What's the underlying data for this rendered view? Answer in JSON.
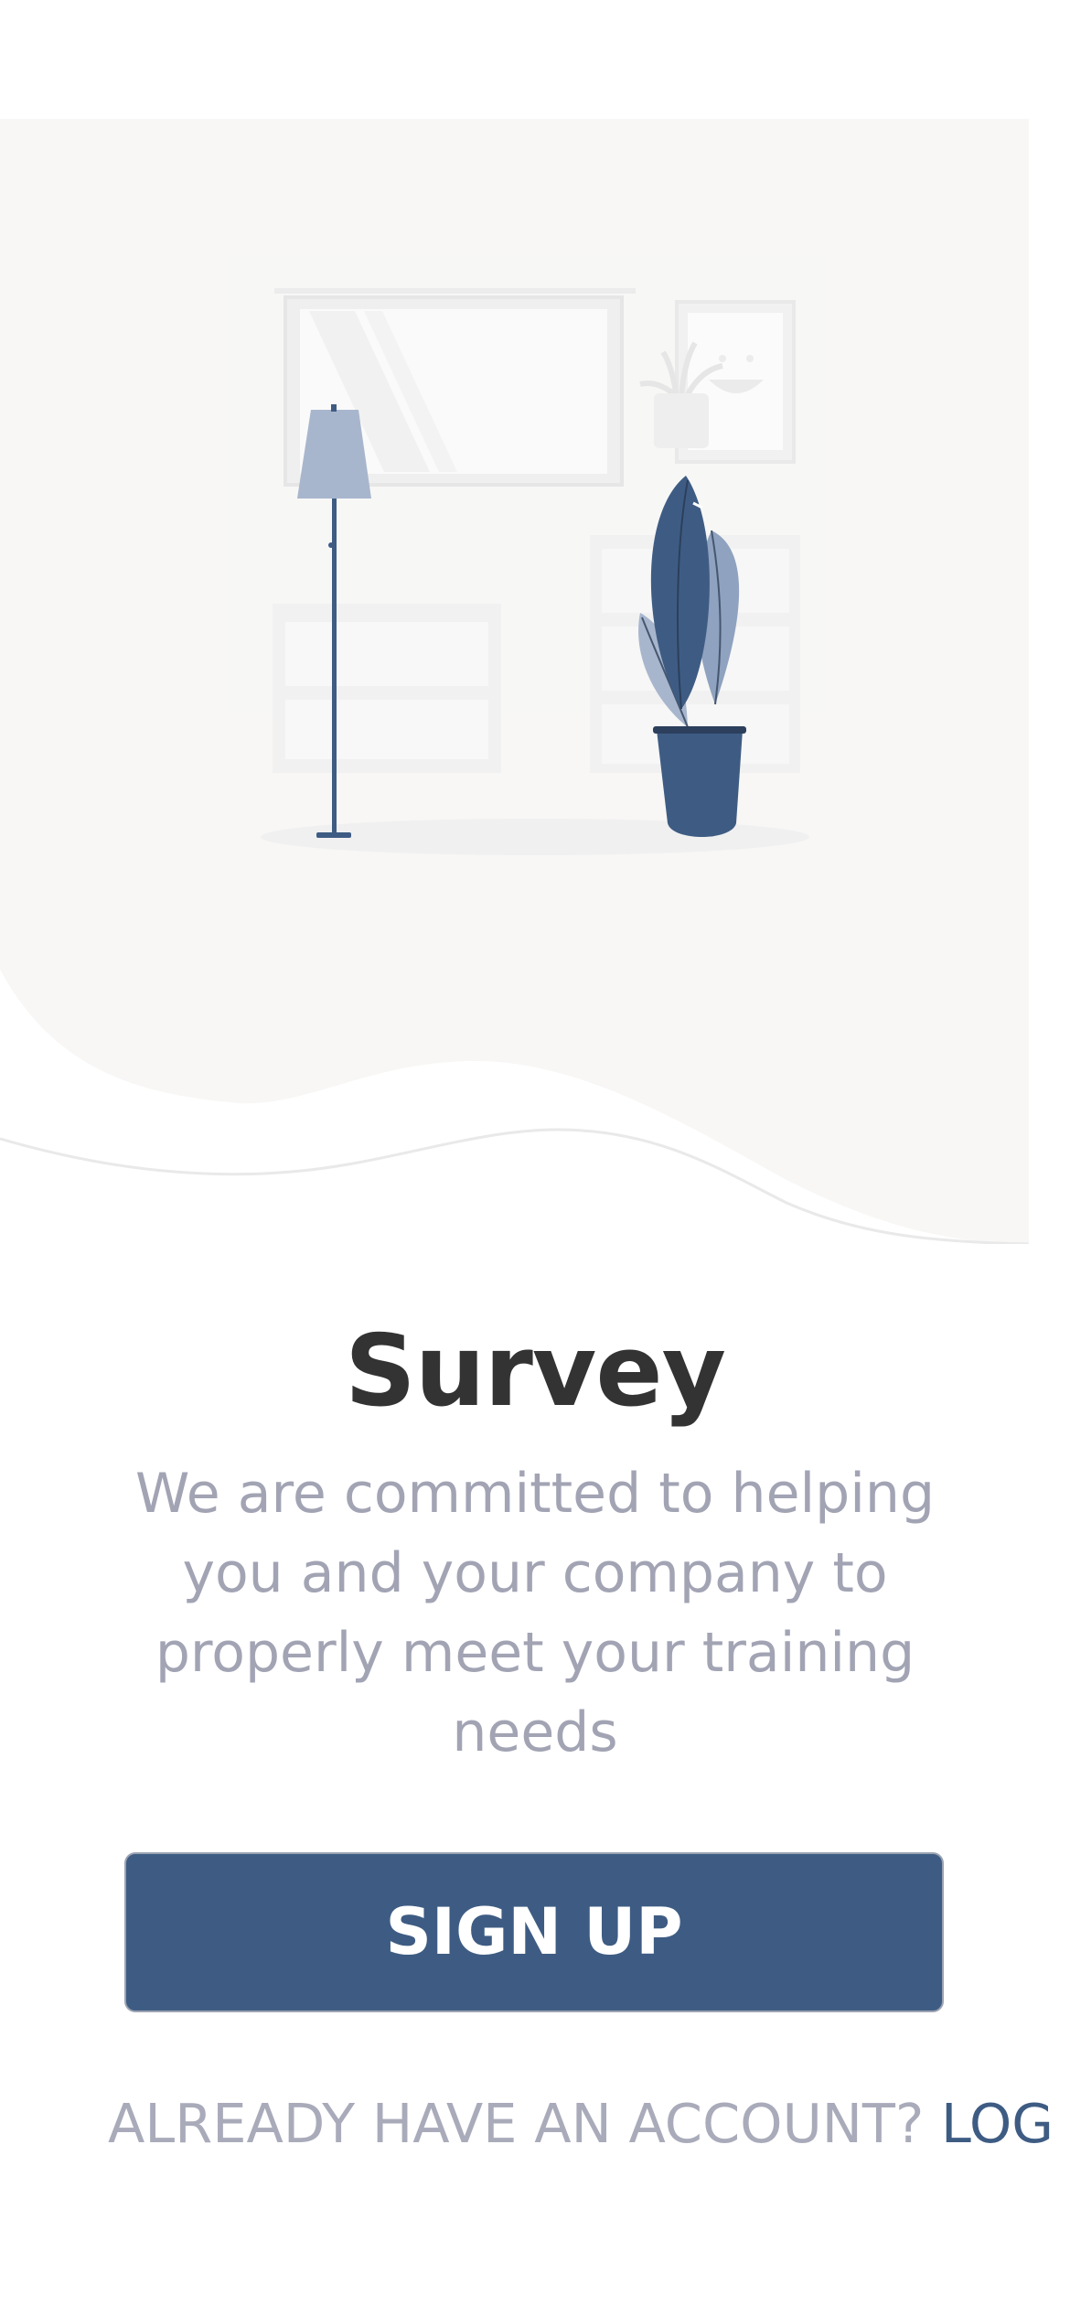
{
  "onboarding": {
    "illustration_icon": "living-room-illustration",
    "title": "Survey",
    "description": "We are committed to helping you and your company to properly meet your training needs",
    "signup_label": "SIGN UP",
    "account_prompt": "ALREADY HAVE AN ACCOUNT? ",
    "login_label": "LOG IN"
  },
  "colors": {
    "primary": "#3e5c83",
    "hero_background": "#f8f7f5",
    "title_text": "#333333",
    "muted_text": "#a2a4b4"
  }
}
